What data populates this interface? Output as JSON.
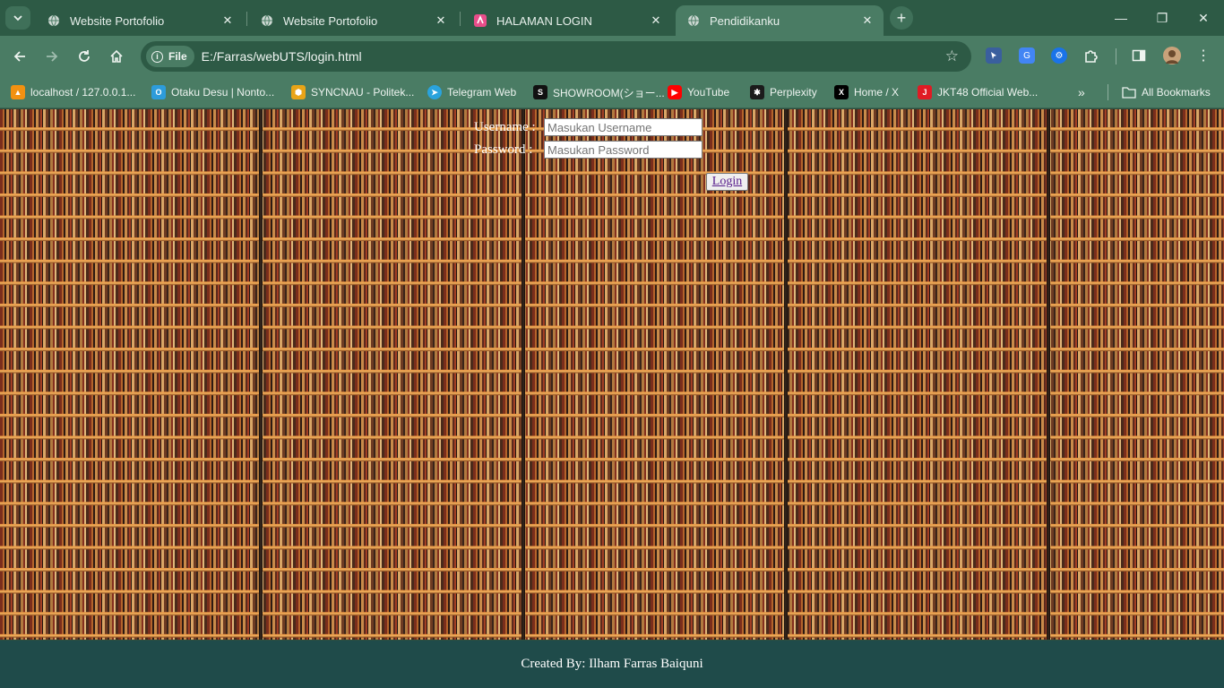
{
  "browser": {
    "tabs": [
      {
        "title": "Website Portofolio",
        "icon": "globe-icon",
        "active": false
      },
      {
        "title": "Website Portofolio",
        "icon": "globe-icon",
        "active": false
      },
      {
        "title": "HALAMAN LOGIN",
        "icon": "pink-app-icon",
        "active": false
      },
      {
        "title": "Pendidikanku",
        "icon": "globe-icon",
        "active": true
      }
    ],
    "close_glyph": "✕",
    "newtab_glyph": "+",
    "window_controls": {
      "minimize": "—",
      "restore": "❐",
      "close": "✕"
    },
    "address": {
      "chip_label": "File",
      "url": "E:/Farras/webUTS/login.html"
    },
    "bookmarks": [
      {
        "label": "localhost / 127.0.0.1...",
        "icon": "phpmyadmin-icon",
        "color": "#f29111"
      },
      {
        "label": "Otaku Desu | Nonto...",
        "icon": "otakudesu-icon",
        "color": "#2d9cdb"
      },
      {
        "label": "SYNCNAU - Politek...",
        "icon": "syncnau-icon",
        "color": "#e8a417"
      },
      {
        "label": "Telegram Web",
        "icon": "telegram-icon",
        "color": "#2aa3dd"
      },
      {
        "label": "SHOWROOM(ショー...",
        "icon": "showroom-icon",
        "color": "#111111"
      },
      {
        "label": "YouTube",
        "icon": "youtube-icon",
        "color": "#ff0000"
      },
      {
        "label": "Perplexity",
        "icon": "perplexity-icon",
        "color": "#1b1b1b"
      },
      {
        "label": "Home / X",
        "icon": "x-icon",
        "color": "#000000"
      },
      {
        "label": "JKT48 Official Web...",
        "icon": "jkt48-icon",
        "color": "#e01b24"
      }
    ],
    "more_glyph": "»",
    "all_bookmarks": "All Bookmarks"
  },
  "page": {
    "username_label": "Username :",
    "username_placeholder": "Masukan Username",
    "password_label": "Password :",
    "password_placeholder": "Masukan Password",
    "login_button": "Login",
    "footer_text": "Created By: Ilham Farras Baiquni"
  },
  "colors": {
    "chrome_frame": "#2d5a45",
    "chrome_toolbar": "#4a7c64",
    "footer_bg": "#1f4b4a",
    "link_visited": "#551a8b"
  }
}
